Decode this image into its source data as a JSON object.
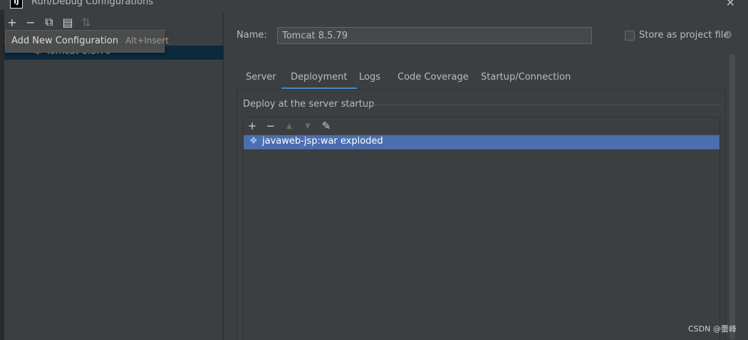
{
  "window": {
    "title": "Run/Debug Configurations",
    "app_icon_text": "IJ",
    "close_symbol": "✕"
  },
  "left_toolbar": {
    "add_icon": "+",
    "remove_icon": "−",
    "copy_icon": "⧉",
    "folder_icon": "▤",
    "sort_icon": "⇅"
  },
  "tooltip": {
    "text": "Add New Configuration",
    "shortcut": "Alt+Insert"
  },
  "tree": {
    "selected_item": "Tomcat 8.5.79",
    "item_icon": "tomcat-icon"
  },
  "config": {
    "name_label": "Name:",
    "name_value": "Tomcat 8.5.79",
    "store_label": "Store as project file",
    "store_checked": false
  },
  "tabs": [
    {
      "label": "Server"
    },
    {
      "label": "Deployment"
    },
    {
      "label": "Logs"
    },
    {
      "label": "Code Coverage"
    },
    {
      "label": "Startup/Connection"
    }
  ],
  "active_tab": "Deployment",
  "deployment": {
    "section_title": "Deploy at the server startup",
    "toolbar": {
      "add": "+",
      "remove": "−",
      "up": "▲",
      "down": "▼",
      "edit": "✎"
    },
    "artifacts": [
      {
        "label": "javaweb-jsp:war exploded",
        "icon": "artifact-icon"
      }
    ]
  },
  "watermark": "CSDN @蕾峰",
  "colors": {
    "background": "#3c3f41",
    "selection": "#4b6eaf",
    "tree_selection": "#0d293e",
    "accent": "#4a88c7"
  }
}
